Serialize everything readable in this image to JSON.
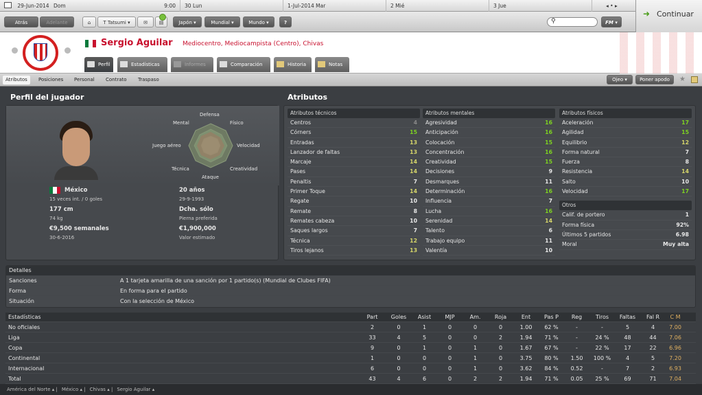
{
  "topbar": {
    "date": "29-Jun-2014",
    "day": "Dom",
    "time": "9:00",
    "days": [
      {
        "num": "30",
        "name": "Lun"
      },
      {
        "num": "1-Jul-2014",
        "name": "Mar"
      },
      {
        "num": "2",
        "name": "Mié"
      },
      {
        "num": "3",
        "name": "Jue"
      }
    ]
  },
  "nav": {
    "back": "Atrás",
    "forward": "Adelante",
    "manager": "T Tatsumi",
    "menu1": "Japón",
    "menu2": "Mundial",
    "menu3": "Mundo",
    "help": "?",
    "fm": "FM",
    "continue": "Continuar"
  },
  "player": {
    "name": "Sergio Aguilar",
    "role": "Mediocentro, Mediocampista (Centro), Chivas",
    "nation": "México",
    "caps": "15 veces int. / 0 goles",
    "age": "20 años",
    "dob": "29-9-1993",
    "height": "177 cm",
    "weight": "74 kg",
    "foot": "Dcha. sólo",
    "foot_label": "Pierna preferida",
    "wage": "€9,500 semanales",
    "contract": "30-6-2016",
    "value": "€1,900,000",
    "value_label": "Valor estimado"
  },
  "tabs": [
    "Perfil",
    "Estadísticas",
    "Informes",
    "Comparación",
    "Historia",
    "Notas"
  ],
  "subnav": [
    "Atributos",
    "Posiciones",
    "Personal",
    "Contrato",
    "Traspaso"
  ],
  "subnav_right": {
    "scout": "Ojeo",
    "support": "Poner apodo"
  },
  "profile_title": "Perfil del jugador",
  "attributes_title": "Atributos",
  "radar_labels": {
    "top": "Defensa",
    "tr": "Físico",
    "r": "Velocidad",
    "br": "Creatividad",
    "bottom": "Ataque",
    "bl": "Técnica",
    "l": "Juego aéreo",
    "tl": "Mental"
  },
  "technical": {
    "title": "Atributos técnicos",
    "items": [
      [
        "Centros",
        "4",
        "gr"
      ],
      [
        "Córners",
        "15",
        "g"
      ],
      [
        "Entradas",
        "13",
        "y"
      ],
      [
        "Lanzador de faltas",
        "13",
        "y"
      ],
      [
        "Marcaje",
        "14",
        "y"
      ],
      [
        "Pases",
        "14",
        "y"
      ],
      [
        "Penaltis",
        "7",
        "w"
      ],
      [
        "Primer Toque",
        "14",
        "y"
      ],
      [
        "Regate",
        "10",
        "w"
      ],
      [
        "Remate",
        "8",
        "w"
      ],
      [
        "Remates cabeza",
        "10",
        "w"
      ],
      [
        "Saques largos",
        "7",
        "w"
      ],
      [
        "Técnica",
        "12",
        "y"
      ],
      [
        "Tiros lejanos",
        "13",
        "y"
      ]
    ]
  },
  "mental": {
    "title": "Atributos mentales",
    "items": [
      [
        "Agresividad",
        "16",
        "g"
      ],
      [
        "Anticipación",
        "16",
        "g"
      ],
      [
        "Colocación",
        "15",
        "g"
      ],
      [
        "Concentración",
        "16",
        "g"
      ],
      [
        "Creatividad",
        "15",
        "g"
      ],
      [
        "Decisiones",
        "9",
        "w"
      ],
      [
        "Desmarques",
        "11",
        "w"
      ],
      [
        "Determinación",
        "16",
        "g"
      ],
      [
        "Influencia",
        "7",
        "w"
      ],
      [
        "Lucha",
        "16",
        "g"
      ],
      [
        "Serenidad",
        "14",
        "y"
      ],
      [
        "Talento",
        "6",
        "w"
      ],
      [
        "Trabajo equipo",
        "11",
        "w"
      ],
      [
        "Valentía",
        "10",
        "w"
      ]
    ]
  },
  "physical": {
    "title": "Atributos físicos",
    "items": [
      [
        "Aceleración",
        "17",
        "g"
      ],
      [
        "Agilidad",
        "15",
        "g"
      ],
      [
        "Equilibrio",
        "12",
        "y"
      ],
      [
        "Forma natural",
        "7",
        "w"
      ],
      [
        "Fuerza",
        "8",
        "w"
      ],
      [
        "Resistencia",
        "14",
        "y"
      ],
      [
        "Salto",
        "10",
        "w"
      ],
      [
        "Velocidad",
        "17",
        "g"
      ]
    ]
  },
  "others": {
    "title": "Otros",
    "items": [
      [
        "Calif. de portero",
        "1"
      ],
      [
        "Forma física",
        "92%"
      ],
      [
        "Últimos 5 partidos",
        "6.98"
      ],
      [
        "Moral",
        "Muy alta"
      ]
    ]
  },
  "details": {
    "title": "Detalles",
    "rows": [
      [
        "Sanciones",
        "A 1 tarjeta amarilla de una sanción por 1 partido(s) (Mundial de Clubes FIFA)"
      ],
      [
        "Forma",
        "En forma para el partido"
      ],
      [
        "Situación",
        "Con la selección de México"
      ]
    ]
  },
  "stats": {
    "headers": [
      "Estadísticas",
      "Part",
      "Goles",
      "Asist",
      "MJP",
      "Am.",
      "Roja",
      "Ent",
      "Pas P",
      "Reg",
      "Tiros",
      "Faltas",
      "Fal R",
      "C M"
    ],
    "rows": [
      [
        "No oficiales",
        "2",
        "0",
        "1",
        "0",
        "0",
        "0",
        "1.00",
        "62 %",
        "-",
        "-",
        "5",
        "4",
        "7.00"
      ],
      [
        "Liga",
        "33",
        "4",
        "5",
        "0",
        "0",
        "2",
        "1.94",
        "71 %",
        "-",
        "24 %",
        "48",
        "44",
        "7.06"
      ],
      [
        "Copa",
        "9",
        "0",
        "1",
        "0",
        "1",
        "0",
        "1.67",
        "67 %",
        "-",
        "22 %",
        "17",
        "22",
        "6.96"
      ],
      [
        "Continental",
        "1",
        "0",
        "0",
        "0",
        "1",
        "0",
        "3.75",
        "80 %",
        "1.50",
        "100 %",
        "4",
        "5",
        "7.20"
      ],
      [
        "Internacional",
        "6",
        "0",
        "0",
        "0",
        "1",
        "0",
        "3.62",
        "84 %",
        "0.52",
        "-",
        "7",
        "2",
        "6.93"
      ],
      [
        "Total",
        "43",
        "4",
        "6",
        "0",
        "2",
        "2",
        "1.94",
        "71 %",
        "0.05",
        "25 %",
        "69",
        "71",
        "7.04"
      ]
    ]
  },
  "breadcrumbs": [
    "América del Norte",
    "México",
    "Chivas",
    "Sergio Aguilar"
  ]
}
